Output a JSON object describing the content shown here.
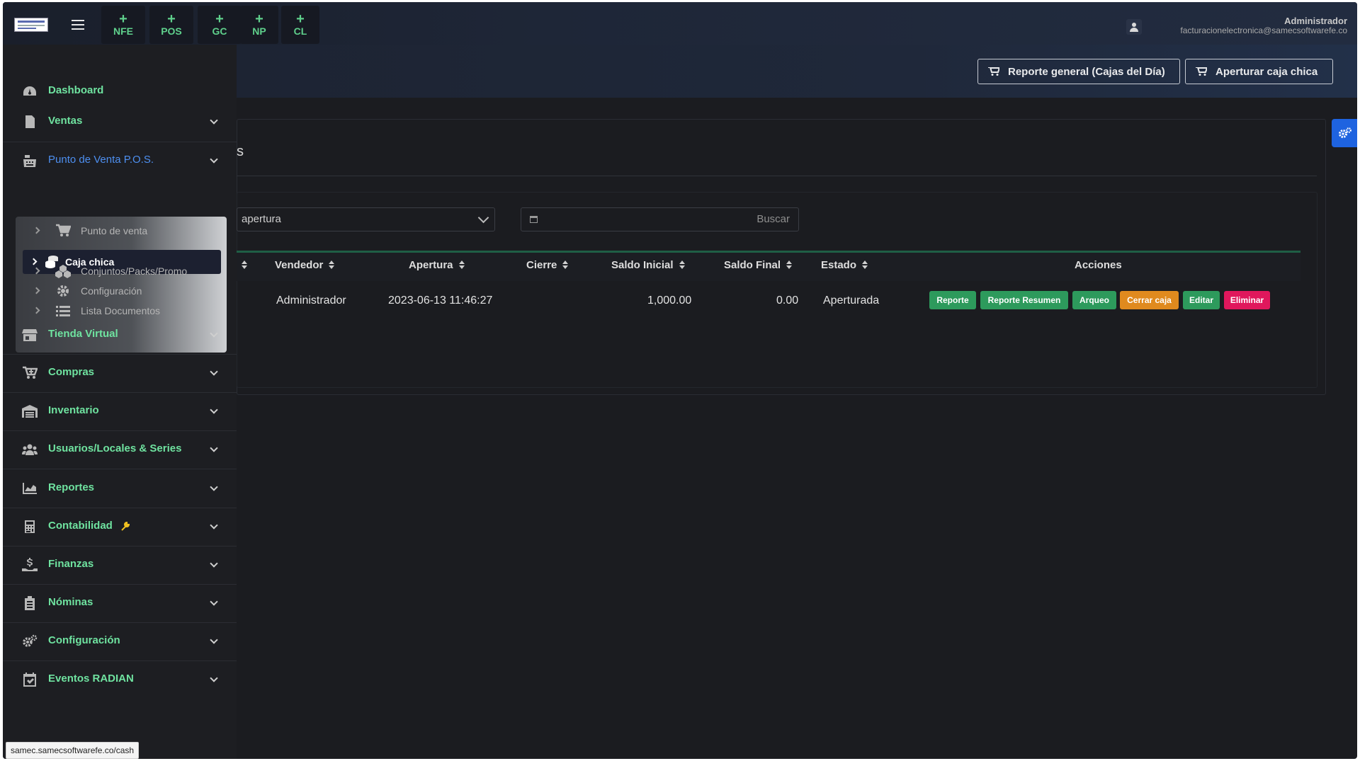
{
  "topbar": {
    "quick_actions": [
      {
        "plus": "+",
        "label": "NFE"
      },
      {
        "plus": "+",
        "label": "POS"
      },
      {
        "plus": "+",
        "label": "GC"
      },
      {
        "plus": "+",
        "label": "NP"
      },
      {
        "plus": "+",
        "label": "CL"
      }
    ],
    "user_name": "Administrador",
    "user_email": "facturacionelectronica@samecsoftwarefe.co"
  },
  "header": {
    "report_button": "Reporte general (Cajas del Día)",
    "open_button": "Aperturar caja chica"
  },
  "sidebar": {
    "items": [
      {
        "label": "Dashboard",
        "icon": "dashboard-icon"
      },
      {
        "label": "Ventas",
        "icon": "document-icon"
      },
      {
        "label": "Punto de Venta P.O.S.",
        "icon": "cash-register-icon"
      },
      {
        "label": "Tienda Virtual",
        "icon": "store-icon"
      },
      {
        "label": "Compras",
        "icon": "cart-plus-icon"
      },
      {
        "label": "Inventario",
        "icon": "warehouse-icon"
      },
      {
        "label": "Usuarios/Locales & Series",
        "icon": "users-icon"
      },
      {
        "label": "Reportes",
        "icon": "chart-area-icon"
      },
      {
        "label": "Contabilidad",
        "icon": "calculator-icon"
      },
      {
        "label": "Finanzas",
        "icon": "hand-dollar-icon"
      },
      {
        "label": "Nóminas",
        "icon": "clipboard-icon"
      },
      {
        "label": "Configuración",
        "icon": "gears-icon"
      },
      {
        "label": "Eventos RADIAN",
        "icon": "calendar-check-icon"
      }
    ],
    "pos_submenu": [
      {
        "label": "Punto de venta",
        "icon": "cart-icon"
      },
      {
        "label": "Caja chica",
        "icon": "coins-icon"
      },
      {
        "label": "Conjuntos/Packs/Promo",
        "icon": "cubes-icon"
      },
      {
        "label": "Configuración",
        "icon": "cog-icon"
      },
      {
        "label": "Lista Documentos",
        "icon": "list-icon"
      }
    ],
    "active_section": "Punto de Venta P.O.S.",
    "active_subitem": "Caja chica"
  },
  "panel": {
    "title": "s",
    "filter_select_value": "apertura",
    "search_label": "Buscar"
  },
  "table": {
    "columns": [
      "Vendedor",
      "Apertura",
      "Cierre",
      "Saldo Inicial",
      "Saldo Final",
      "Estado",
      "Acciones"
    ],
    "rows": [
      {
        "vendedor": "Administrador",
        "apertura": "2023-06-13 11:46:27",
        "cierre": "",
        "saldo_inicial": "1,000.00",
        "saldo_final": "0.00",
        "estado": "Aperturada"
      }
    ],
    "actions": [
      {
        "label": "Reporte",
        "color": "#2d9a5c"
      },
      {
        "label": "Reporte Resumen",
        "color": "#2d9a5c"
      },
      {
        "label": "Arqueo",
        "color": "#2d9a5c"
      },
      {
        "label": "Cerrar caja",
        "color": "#e08a1e"
      },
      {
        "label": "Editar",
        "color": "#2d9a5c"
      },
      {
        "label": "Eliminar",
        "color": "#e0175c"
      }
    ]
  },
  "statusbar": {
    "url": "samec.samecsoftwarefe.co/cash"
  },
  "colors": {
    "accent_green": "#6fe3a0",
    "active_blue": "#4d8ff0",
    "gear_tab": "#1e63e0"
  }
}
